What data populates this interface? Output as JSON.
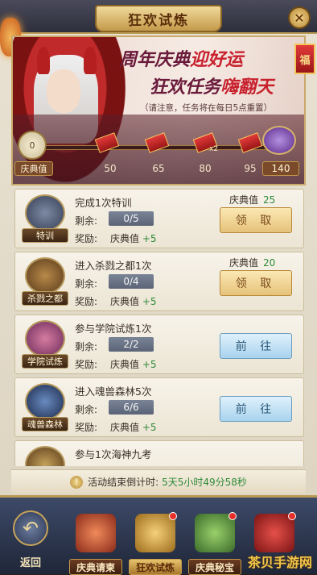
{
  "header": {
    "title": "狂欢试炼",
    "close": "✕"
  },
  "side_tag": "福",
  "banner": {
    "headline1_pre": "周年庆典",
    "headline1_hi": "迎好运",
    "headline2_pre": "狂欢任务",
    "headline2_hi": "嗨翻天",
    "notice": "（请注意，任务将在每日5点重置）",
    "score": "0",
    "score_label": "庆典值",
    "milestones": [
      "50",
      "65",
      "80",
      "95"
    ],
    "multiplier": "x2",
    "final_milestone": "140"
  },
  "tasks": [
    {
      "icon": "shield-icon",
      "emblem": "特训",
      "name": "完成1次特训",
      "remain_label": "剩余:",
      "remain": "0/5",
      "reward_label": "奖励:",
      "reward_text": "庆典值",
      "reward_value": "+5",
      "points_label": "庆典值",
      "points": "25",
      "button": "领 取",
      "button_type": "claim"
    },
    {
      "icon": "goblet-icon",
      "emblem": "杀戮之都",
      "name": "进入杀戮之都1次",
      "remain_label": "剩余:",
      "remain": "0/4",
      "reward_label": "奖励:",
      "reward_text": "庆典值",
      "reward_value": "+5",
      "points_label": "庆典值",
      "points": "20",
      "button": "领 取",
      "button_type": "claim"
    },
    {
      "icon": "castle-icon",
      "emblem": "学院试炼",
      "name": "参与学院试炼1次",
      "remain_label": "剩余:",
      "remain": "2/2",
      "reward_label": "奖励:",
      "reward_text": "庆典值",
      "reward_value": "+5",
      "points_label": "",
      "points": "",
      "button": "前 往",
      "button_type": "go"
    },
    {
      "icon": "beast-icon",
      "emblem": "魂兽森林",
      "name": "进入魂兽森林5次",
      "remain_label": "剩余:",
      "remain": "6/6",
      "reward_label": "奖励:",
      "reward_text": "庆典值",
      "reward_value": "+5",
      "points_label": "",
      "points": "",
      "button": "前 往",
      "button_type": "go"
    },
    {
      "icon": "trident-icon",
      "emblem": "",
      "name": "参与1次海神九考",
      "remain_label": "",
      "remain": "",
      "reward_label": "",
      "reward_text": "",
      "reward_value": "",
      "points_label": "",
      "points": "",
      "button": "",
      "button_type": "go"
    }
  ],
  "timer": {
    "label": "活动结束倒计时:",
    "value": "5天5小时49分58秒"
  },
  "nav": {
    "back": "返回",
    "tabs": [
      {
        "label": "庆典请柬",
        "icon": "gift-box-icon",
        "color": "#c8452f"
      },
      {
        "label": "狂欢试炼",
        "icon": "trophy-icon",
        "color": "#d9a63a"
      },
      {
        "label": "庆典秘宝",
        "icon": "treasure-icon",
        "color": "#5a9a3a"
      },
      {
        "label": "",
        "icon": "money-bag-icon",
        "color": "#b0282a"
      }
    ]
  },
  "watermark": "茶贝手游网"
}
